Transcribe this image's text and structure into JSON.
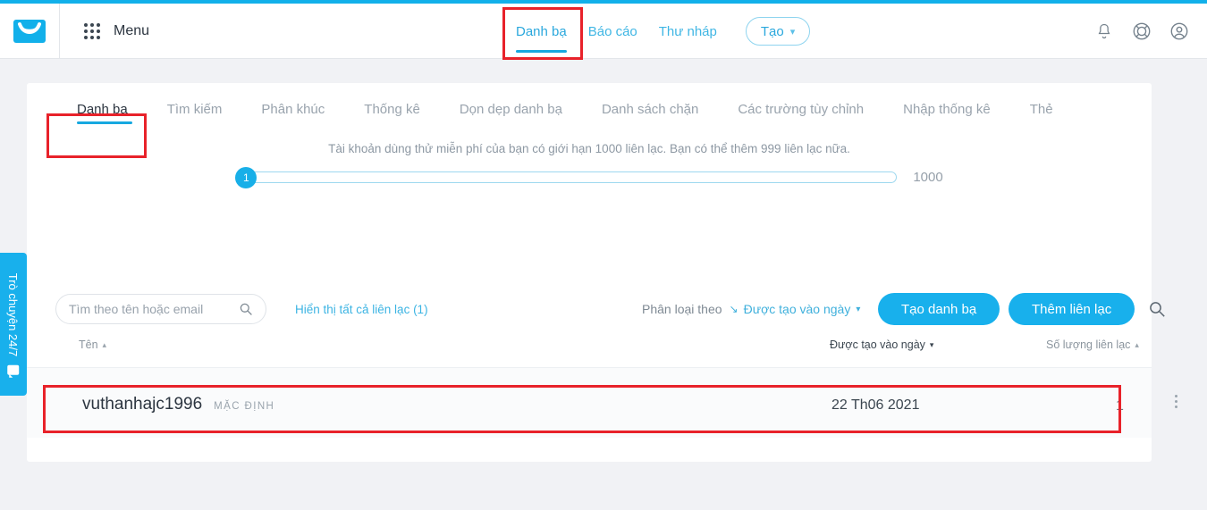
{
  "header": {
    "logo_icon": "envelope-logo-icon",
    "apps_icon": "grid-apps-icon",
    "menu_label": "Menu",
    "nav": [
      {
        "label": "Danh bạ",
        "active": true
      },
      {
        "label": "Báo cáo",
        "active": false
      },
      {
        "label": "Thư nháp",
        "active": false
      }
    ],
    "create_button": {
      "label": "Tạo",
      "caret": "⌄"
    },
    "right_icons": [
      "bell-icon",
      "lifebuoy-help-icon",
      "user-avatar-icon"
    ]
  },
  "tabs": [
    {
      "label": "Danh bạ",
      "active": true
    },
    {
      "label": "Tìm kiếm",
      "active": false
    },
    {
      "label": "Phân khúc",
      "active": false
    },
    {
      "label": "Thống kê",
      "active": false
    },
    {
      "label": "Dọn dẹp danh bạ",
      "active": false
    },
    {
      "label": "Danh sách chặn",
      "active": false
    },
    {
      "label": "Các trường tùy chỉnh",
      "active": false
    },
    {
      "label": "Nhập thống kê",
      "active": false
    },
    {
      "label": "Thẻ",
      "active": false
    }
  ],
  "quota": {
    "notice": "Tài khoản dùng thử miễn phí của bạn có giới hạn 1000 liên lạc. Bạn có thể thêm 999 liên lạc nữa.",
    "slider_value": "1",
    "slider_max_label": "1000"
  },
  "toolbar": {
    "search_placeholder": "Tìm theo tên hoặc email",
    "search_value": "",
    "search_icon": "search-icon",
    "show_all_link": "Hiển thị tất cả liên lạc (1)",
    "sort_label": "Phân loại theo",
    "sort_value": "Được tạo vào ngày",
    "sort_arrow_icon": "arrow-down-right-icon",
    "sort_caret": "▾",
    "create_list_button": "Tạo danh bạ",
    "add_contact_button": "Thêm liên lạc",
    "search_icon_right": "search-icon"
  },
  "table": {
    "columns": [
      {
        "label": "Tên",
        "sort": "▴"
      },
      {
        "label": "Được tạo vào ngày",
        "sort": "▾"
      },
      {
        "label": "Số lượng liên lạc",
        "sort": "▴"
      }
    ],
    "rows": [
      {
        "name": "vuthanhajc1996",
        "badge": "MẶC ĐỊNH",
        "created": "22 Th06 2021",
        "count": "1",
        "menu_icon": "kebab-menu-icon"
      }
    ]
  },
  "chat_widget": {
    "label": "Trò chuyện 24/7",
    "icon": "chat-bubble-icon"
  },
  "colors": {
    "accent": "#18b0ec",
    "nav_link": "#3fb6e4",
    "annotation": "#e8222a",
    "page_bg": "#f1f2f5",
    "row_bg": "#fafbfc"
  }
}
